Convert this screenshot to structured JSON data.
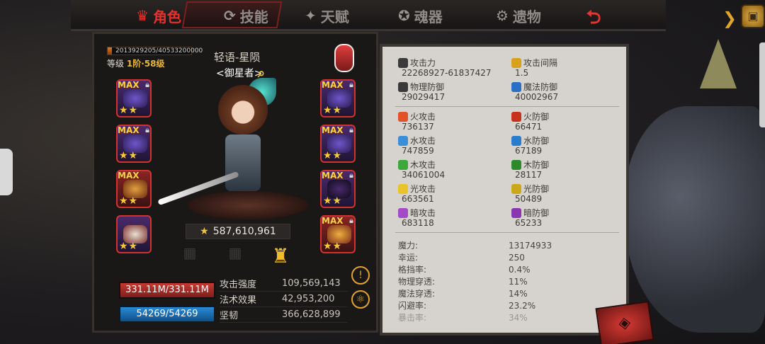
{
  "tabs": [
    {
      "label": "角色",
      "icon": "character-icon",
      "active": true
    },
    {
      "label": "技能",
      "icon": "skill-icon",
      "active": false
    },
    {
      "label": "天赋",
      "icon": "talent-icon",
      "active": false
    },
    {
      "label": "魂器",
      "icon": "soul-artifact-icon",
      "active": false
    },
    {
      "label": "遗物",
      "icon": "relic-icon",
      "active": false
    }
  ],
  "hero": {
    "exp_text": "2013929205/40533200000",
    "exp_progress": 0.05,
    "level_prefix": "等级",
    "level_rank": "1阶",
    "level_sep": "·",
    "level_value": "58级",
    "name": "轻语-星陨",
    "title": "<御星者>",
    "power": "587,610,961",
    "hp": "331.11M/331.11M",
    "mp": "54269/54269"
  },
  "equipment": {
    "max_label": "MAX",
    "left": [
      {
        "stars": "★★"
      },
      {
        "stars": "★★"
      },
      {
        "stars": "★★"
      },
      {
        "stars": "★★"
      }
    ],
    "right": [
      {
        "stars": "★★"
      },
      {
        "stars": "★★"
      },
      {
        "stars": "★★"
      },
      {
        "stars": "★★"
      }
    ]
  },
  "attributes": [
    {
      "label": "攻击强度",
      "value": "109,569,143"
    },
    {
      "label": "法术效果",
      "value": "42,953,200"
    },
    {
      "label": "坚韧",
      "value": "366,628,899"
    }
  ],
  "stats_top": [
    {
      "label": "攻击力",
      "value": "22268927-61837427",
      "color": "#3a3a3a"
    },
    {
      "label": "攻击间隔",
      "value": "1.5",
      "color": "#d6a21c"
    },
    {
      "label": "物理防御",
      "value": "29029417",
      "color": "#3a3a3a"
    },
    {
      "label": "魔法防御",
      "value": "40002967",
      "color": "#2a6fc4"
    }
  ],
  "stats_elem": [
    {
      "label": "火攻击",
      "value": "736137",
      "color": "#e0532a"
    },
    {
      "label": "火防御",
      "value": "66471",
      "color": "#c7321c"
    },
    {
      "label": "水攻击",
      "value": "747859",
      "color": "#3a8fd8"
    },
    {
      "label": "水防御",
      "value": "67189",
      "color": "#2a7ccc"
    },
    {
      "label": "木攻击",
      "value": "34061004",
      "color": "#3aa83a"
    },
    {
      "label": "木防御",
      "value": "28117",
      "color": "#2c8a2c"
    },
    {
      "label": "光攻击",
      "value": "663561",
      "color": "#e8c42a"
    },
    {
      "label": "光防御",
      "value": "50489",
      "color": "#caa81a"
    },
    {
      "label": "暗攻击",
      "value": "683118",
      "color": "#a44ac8"
    },
    {
      "label": "暗防御",
      "value": "65233",
      "color": "#8a36b0"
    }
  ],
  "stats_misc": [
    {
      "label": "魔力:",
      "value": "13174933"
    },
    {
      "label": "幸运:",
      "value": "250"
    },
    {
      "label": "格挡率:",
      "value": "0.4%"
    },
    {
      "label": "物理穿透:",
      "value": "11%"
    },
    {
      "label": "魔法穿透:",
      "value": "14%"
    },
    {
      "label": "闪避率:",
      "value": "23.2%"
    },
    {
      "label": "暴击率:",
      "value": "34%"
    }
  ]
}
